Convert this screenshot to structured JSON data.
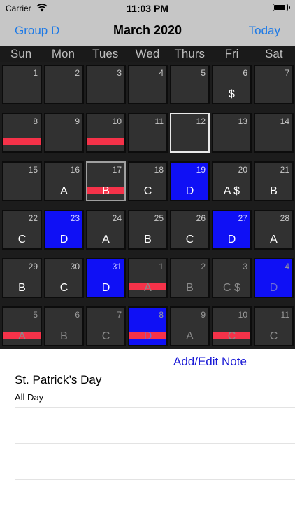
{
  "status": {
    "carrier": "Carrier",
    "time": "11:03 PM"
  },
  "nav": {
    "left": "Group D",
    "title": "March 2020",
    "right": "Today"
  },
  "weekdays": [
    "Sun",
    "Mon",
    "Tues",
    "Wed",
    "Thurs",
    "Fri",
    "Sat"
  ],
  "calendar": {
    "rows": [
      [
        {
          "n": "1",
          "l": ""
        },
        {
          "n": "2",
          "l": ""
        },
        {
          "n": "3",
          "l": ""
        },
        {
          "n": "4",
          "l": ""
        },
        {
          "n": "5",
          "l": ""
        },
        {
          "n": "6",
          "l": "$"
        },
        {
          "n": "7",
          "l": ""
        }
      ],
      [
        {
          "n": "8",
          "l": "",
          "bar": true
        },
        {
          "n": "9",
          "l": ""
        },
        {
          "n": "10",
          "l": "",
          "bar": true
        },
        {
          "n": "11",
          "l": ""
        },
        {
          "n": "12",
          "l": "",
          "today": true
        },
        {
          "n": "13",
          "l": ""
        },
        {
          "n": "14",
          "l": ""
        }
      ],
      [
        {
          "n": "15",
          "l": ""
        },
        {
          "n": "16",
          "l": "A"
        },
        {
          "n": "17",
          "l": "B",
          "bar": true,
          "sel": true
        },
        {
          "n": "18",
          "l": "C"
        },
        {
          "n": "19",
          "l": "D",
          "blue": true
        },
        {
          "n": "20",
          "l": "A $"
        },
        {
          "n": "21",
          "l": "B"
        }
      ],
      [
        {
          "n": "22",
          "l": "C"
        },
        {
          "n": "23",
          "l": "D",
          "blue": true
        },
        {
          "n": "24",
          "l": "A"
        },
        {
          "n": "25",
          "l": "B"
        },
        {
          "n": "26",
          "l": "C"
        },
        {
          "n": "27",
          "l": "D",
          "blue": true
        },
        {
          "n": "28",
          "l": "A"
        }
      ],
      [
        {
          "n": "29",
          "l": "B"
        },
        {
          "n": "30",
          "l": "C"
        },
        {
          "n": "31",
          "l": "D",
          "blue": true
        },
        {
          "n": "1",
          "l": "A",
          "bar": true,
          "other": true
        },
        {
          "n": "2",
          "l": "B",
          "other": true
        },
        {
          "n": "3",
          "l": "C $",
          "other": true
        },
        {
          "n": "4",
          "l": "D",
          "blue": true,
          "other": true
        }
      ],
      [
        {
          "n": "5",
          "l": "A",
          "bar": true,
          "other": true
        },
        {
          "n": "6",
          "l": "B",
          "other": true
        },
        {
          "n": "7",
          "l": "C",
          "other": true
        },
        {
          "n": "8",
          "l": "D",
          "blue": true,
          "bar": true,
          "other": true
        },
        {
          "n": "9",
          "l": "A",
          "other": true
        },
        {
          "n": "10",
          "l": "C",
          "bar": true,
          "other": true
        },
        {
          "n": "11",
          "l": "C",
          "other": true
        }
      ]
    ]
  },
  "notes": {
    "add_label": "Add/Edit Note",
    "title": "St. Patrick’s Day",
    "subtitle": "All Day"
  },
  "colors": {
    "accent": "#1e7ae6",
    "shift_blue": "#0f10f5",
    "event_red": "#f53249"
  }
}
